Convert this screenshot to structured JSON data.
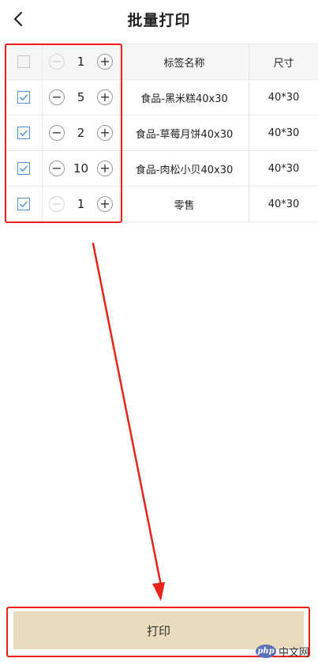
{
  "header": {
    "title": "批量打印",
    "back_icon": "chevron-left-icon"
  },
  "table": {
    "columns": [
      "",
      "",
      "标签名称",
      "尺寸"
    ],
    "header_row": {
      "checked": false,
      "qty": "1",
      "qty_disabled": true
    },
    "rows": [
      {
        "checked": true,
        "qty": "5",
        "name": "食品-黑米糕40x30",
        "size": "40*30"
      },
      {
        "checked": true,
        "qty": "2",
        "name": "食品-草莓月饼40x30",
        "size": "40*30"
      },
      {
        "checked": true,
        "qty": "10",
        "name": "食品-肉松小贝40x30",
        "size": "40*30"
      },
      {
        "checked": true,
        "qty": "1",
        "name": "零售",
        "size": "40*30"
      }
    ]
  },
  "footer": {
    "print_label": "打印"
  },
  "watermark": {
    "logo": "php",
    "text": "中文网"
  },
  "colors": {
    "accent_red": "#e8231a",
    "checkbox_blue": "#4a90d9",
    "print_button_bg": "#e8dcbc"
  }
}
